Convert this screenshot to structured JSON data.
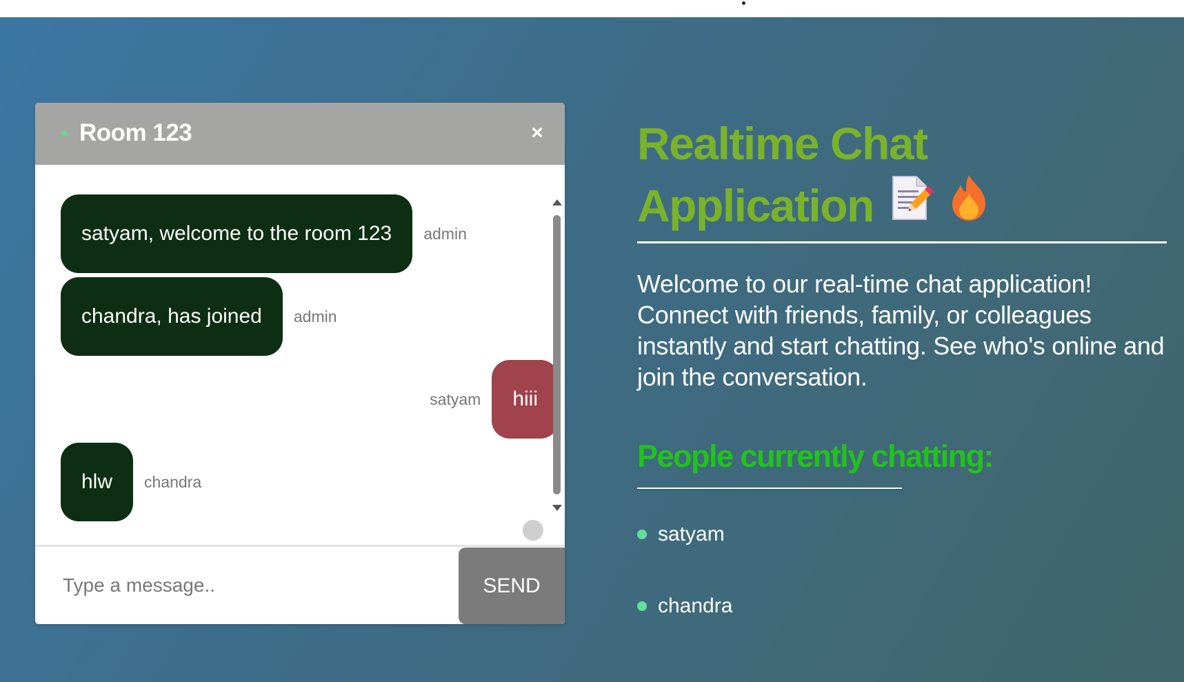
{
  "colors": {
    "online": "#5fe09a",
    "hero_title": "#7ab32a",
    "people_heading": "#22c21c",
    "bubble_other": "#0d2e12",
    "bubble_mine": "#a0434c"
  },
  "chat": {
    "room_title": "Room 123",
    "close_icon": "×",
    "messages": [
      {
        "text": "satyam, welcome to the room 123",
        "sender": "admin",
        "side": "left"
      },
      {
        "text": "chandra, has joined",
        "sender": "admin",
        "side": "left"
      },
      {
        "text": "hiii",
        "sender": "satyam",
        "side": "right"
      },
      {
        "text": "hlw",
        "sender": "chandra",
        "side": "left"
      }
    ],
    "input_placeholder": "Type a message..",
    "send_label": "SEND"
  },
  "hero": {
    "title_line1": "Realtime Chat",
    "title_line2": "Application",
    "icons": [
      "memo-icon",
      "fire-icon"
    ],
    "description": "Welcome to our real-time chat application! Connect with friends, family, or colleagues instantly and start chatting. See who's online and join the conversation."
  },
  "people": {
    "heading": "People currently chatting:",
    "list": [
      "satyam",
      "chandra"
    ]
  }
}
